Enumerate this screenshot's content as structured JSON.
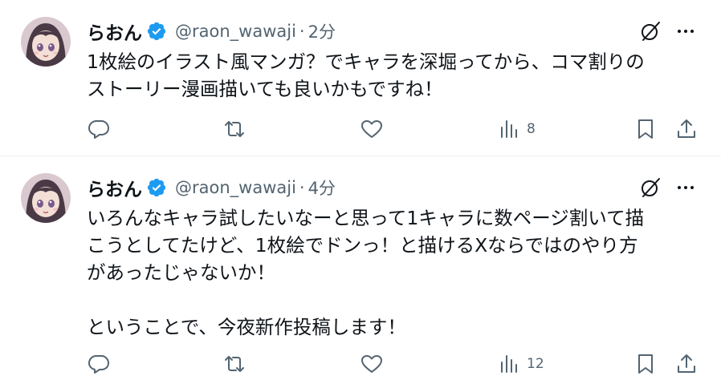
{
  "colors": {
    "text_primary": "#0f1419",
    "text_secondary": "#536471",
    "verified_badge": "#1d9bf0",
    "divider": "#eff3f4"
  },
  "tweets": [
    {
      "author_name": "らおん",
      "handle": "@raon_wawaji",
      "separator": "·",
      "time": "2分",
      "text": "1枚絵のイラスト風マンガ？でキャラを深堀ってから、コマ割りの\nストーリー漫画描いても良いかもですね！",
      "views": "8",
      "icons": [
        "avatar",
        "verified-badge-icon",
        "grok-icon",
        "more-icon",
        "reply-icon",
        "retweet-icon",
        "like-icon",
        "views-icon",
        "bookmark-icon",
        "share-icon"
      ]
    },
    {
      "author_name": "らおん",
      "handle": "@raon_wawaji",
      "separator": "·",
      "time": "4分",
      "text": "いろんなキャラ試したいなーと思って1キャラに数ページ割いて描\nこうとしてたけど、1枚絵でドンっ！と描けるXならではのやり方\nがあったじゃないか！\n\nということで、今夜新作投稿します！",
      "views": "12",
      "icons": [
        "avatar",
        "verified-badge-icon",
        "grok-icon",
        "more-icon",
        "reply-icon",
        "retweet-icon",
        "like-icon",
        "views-icon",
        "bookmark-icon",
        "share-icon"
      ]
    }
  ]
}
